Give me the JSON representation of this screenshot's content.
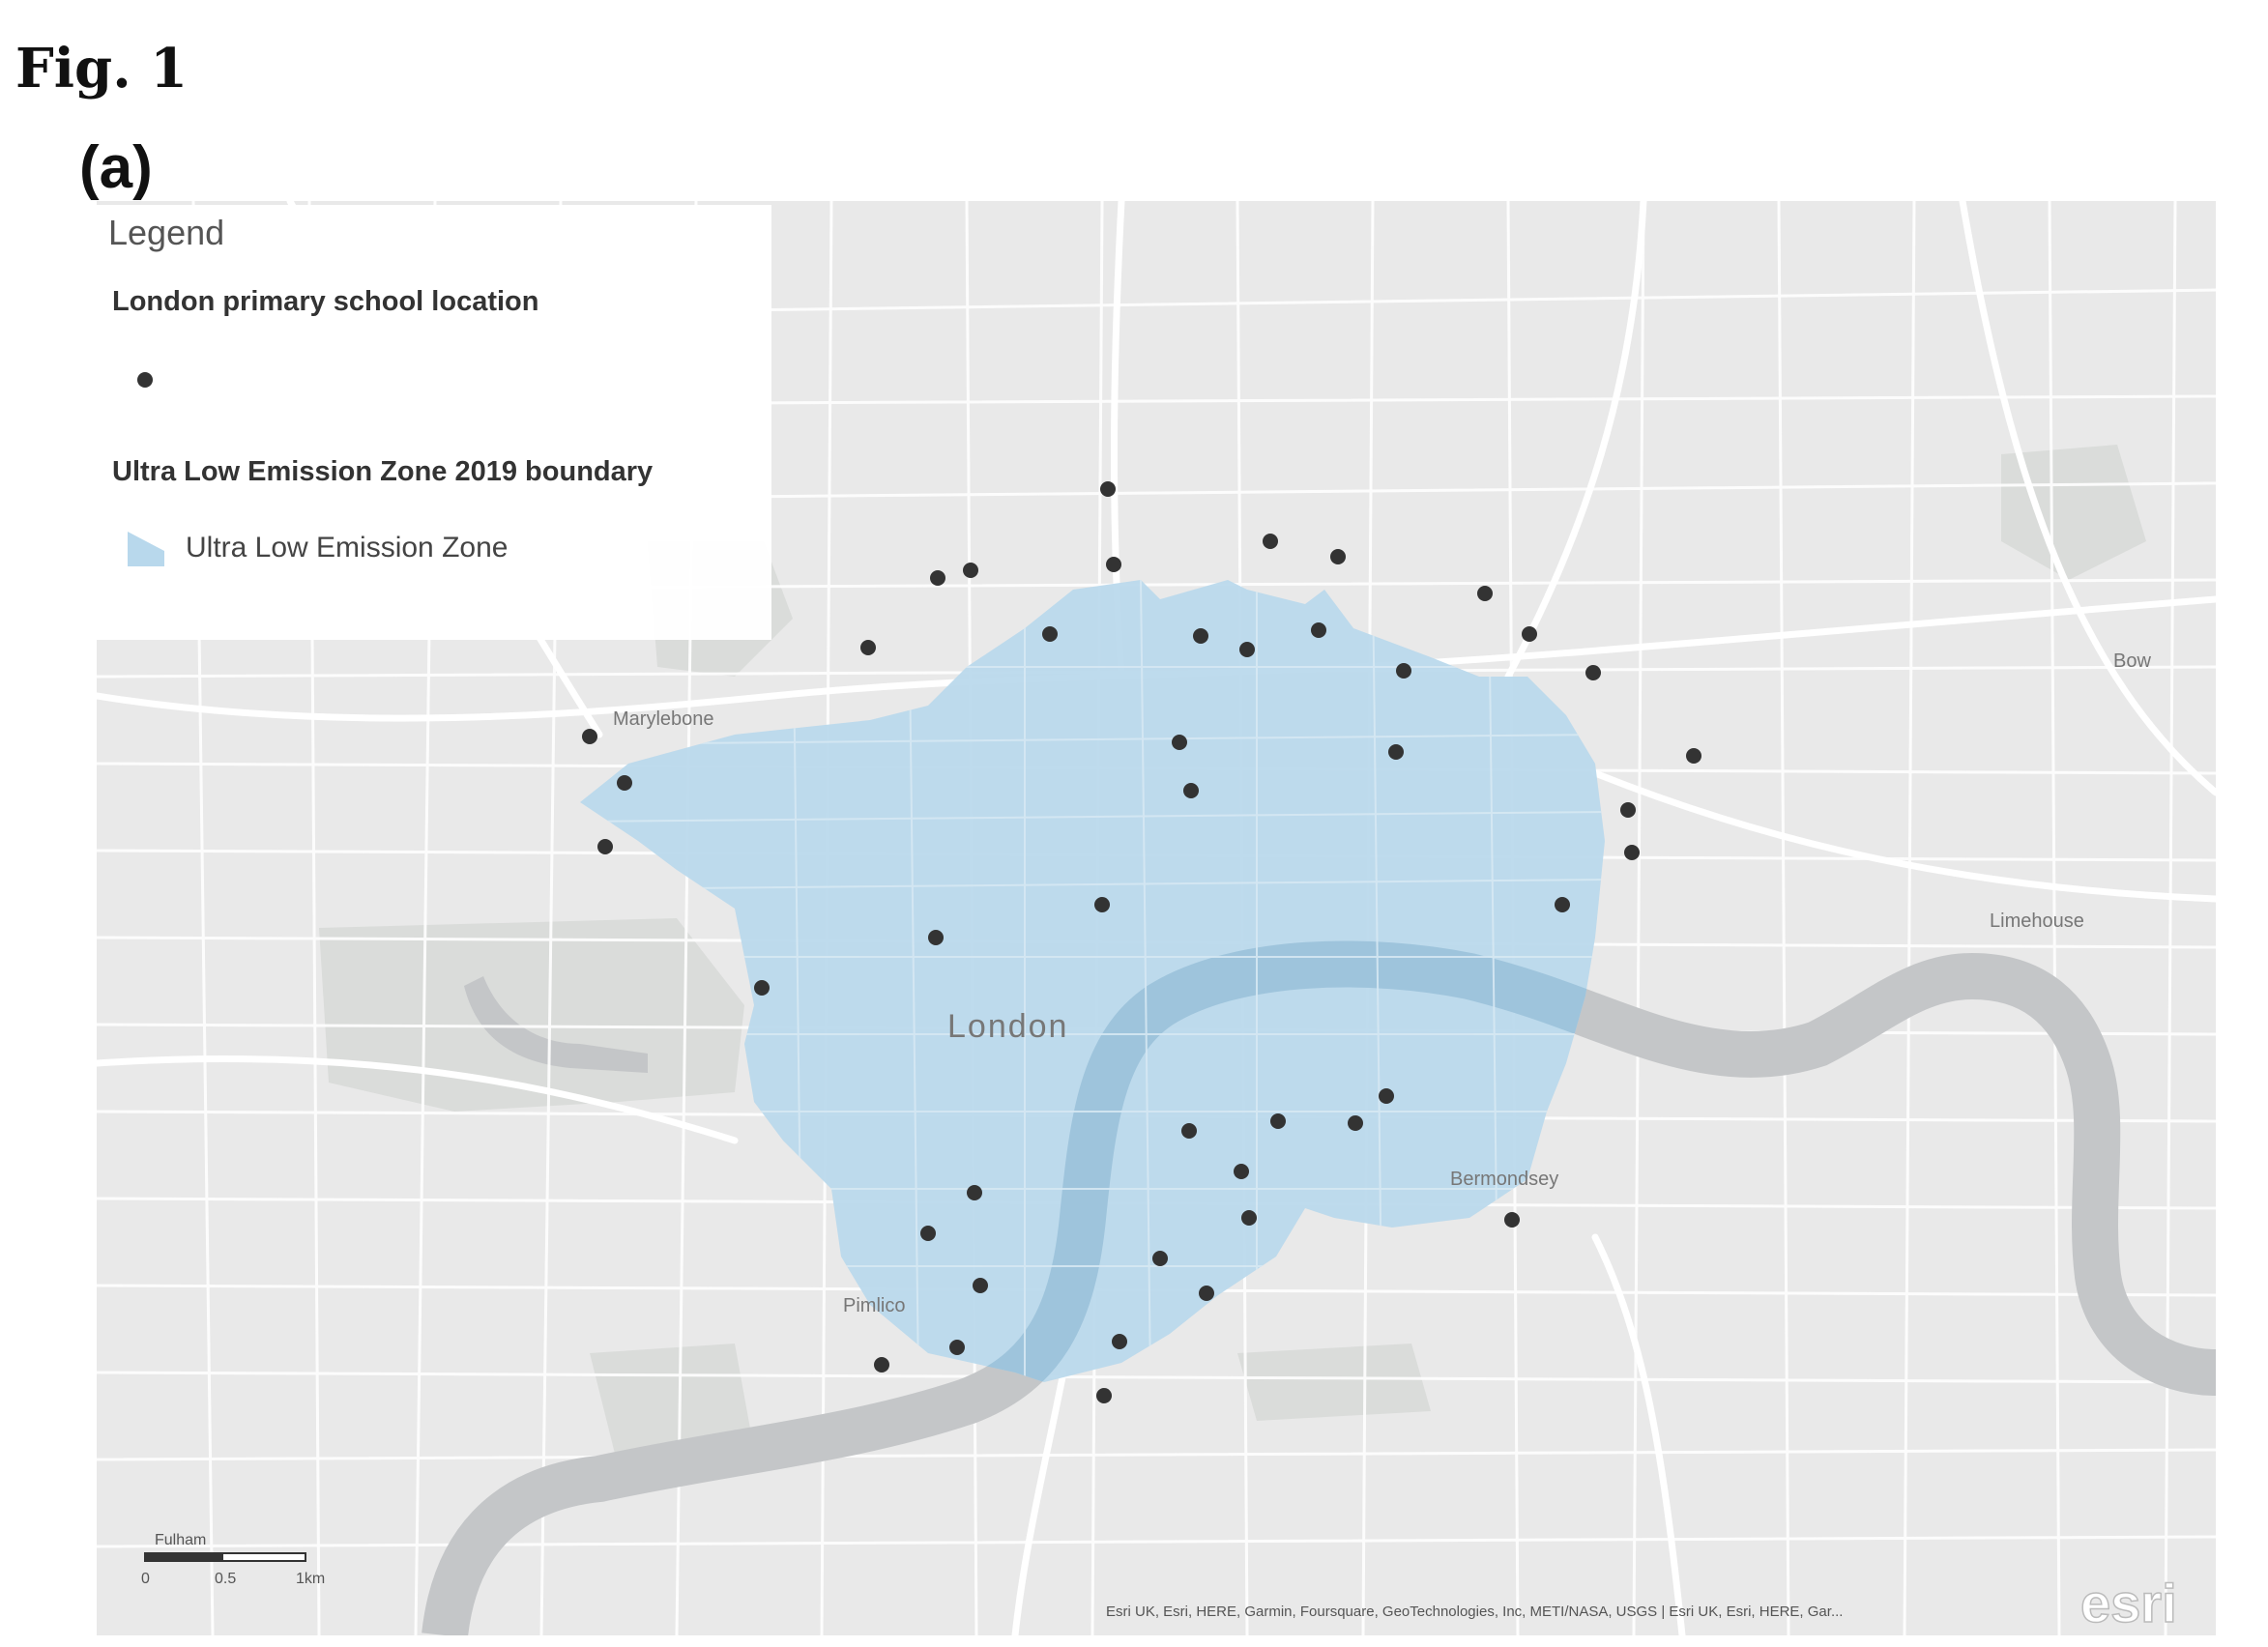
{
  "figure": {
    "fig_label": "Fig. 1",
    "panel_label": "(a)"
  },
  "legend": {
    "title": "Legend",
    "layer1_title": "London primary school location",
    "layer2_title": "Ultra Low Emission Zone 2019 boundary",
    "layer2_item": "Ultra Low Emission Zone",
    "dot_color": "#333333",
    "zone_color": "#b8d8ec"
  },
  "places": {
    "london": "London",
    "marylebone": "Marylebone",
    "bow": "Bow",
    "limehouse": "Limehouse",
    "bermondsey": "Bermondsey",
    "pimlico": "Pimlico"
  },
  "scale_bar": {
    "place": "Fulham",
    "tick0": "0",
    "tick1": "0.5",
    "tick2": "1km"
  },
  "attribution": "Esri UK, Esri, HERE, Garmin, Foursquare, GeoTechnologies, Inc, METI/NASA, USGS | Esri UK, Esri, HERE, Gar...",
  "logo": "esri",
  "colors": {
    "background": "#e9e9e9",
    "roads": "#ffffff",
    "parks": "#dadcda",
    "water": "#c4c6c8",
    "zone": "#b8d8ec",
    "river_in_zone": "#9ec4dc",
    "dot": "#333333"
  }
}
